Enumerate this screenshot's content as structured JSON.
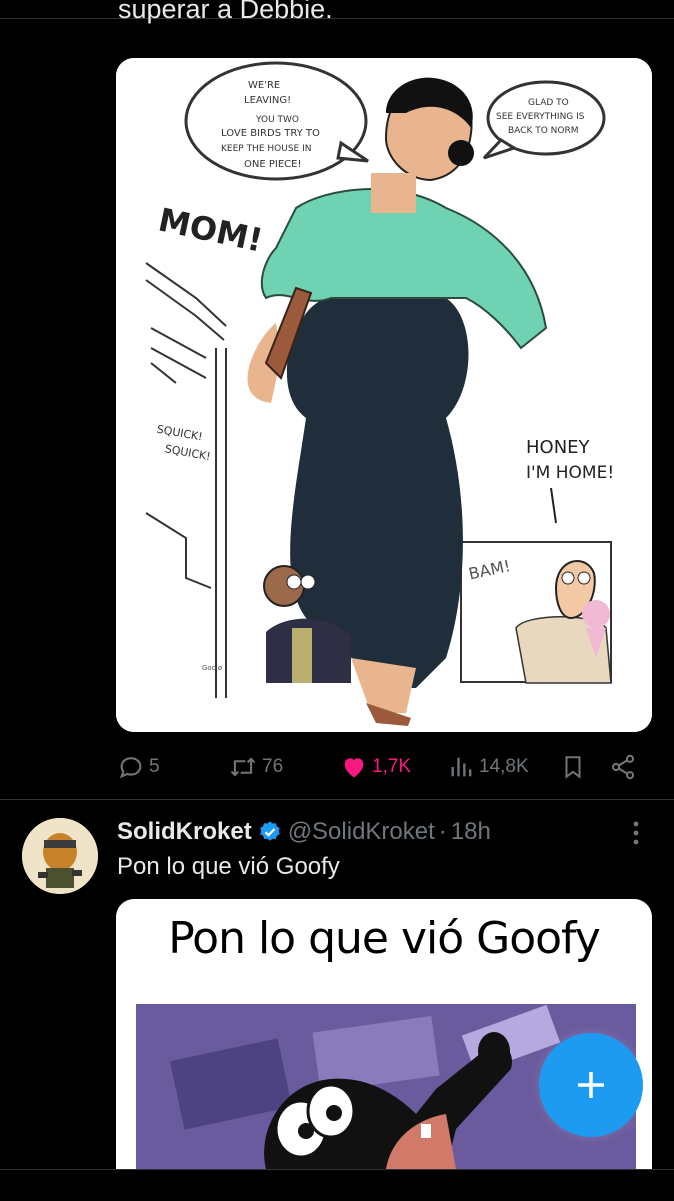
{
  "previous_tweet": {
    "text_cut": "superar a Debbie.",
    "comic": {
      "bubble_left": [
        "WE'RE",
        "LEAVING!",
        "YOU TWO",
        "LOVE BIRDS TRY TO",
        "KEEP THE HOUSE IN",
        "ONE PIECE!"
      ],
      "bubble_right": [
        "GLAD TO",
        "SEE EVERYTHING IS",
        "BACK TO NORM"
      ],
      "mom_shout": "MOM!",
      "squick": [
        "SQUICK!",
        "SQUICK!"
      ],
      "honey_text": [
        "HONEY",
        "I'M HOME!"
      ],
      "bam": "BAM!",
      "signature": "Goo'ø"
    },
    "actions": {
      "replies": "5",
      "reposts": "76",
      "likes": "1,7K",
      "views": "14,8K"
    }
  },
  "tweet": {
    "display_name": "SolidKroket",
    "handle": "@SolidKroket",
    "separator": "·",
    "time": "18h",
    "text": "Pon lo que vió Goofy",
    "media_caption": "Pon lo que vió Goofy"
  },
  "colors": {
    "background": "#000000",
    "text": "#e7e9ea",
    "muted": "#71767b",
    "like": "#f91880",
    "accent": "#1d9bf0"
  },
  "icons": {
    "reply": "reply-icon",
    "repost": "repost-icon",
    "like": "heart-icon",
    "views": "views-icon",
    "bookmark": "bookmark-icon",
    "share": "share-icon",
    "verified": "verified-badge-icon",
    "more": "more-icon",
    "compose": "plus-icon"
  }
}
